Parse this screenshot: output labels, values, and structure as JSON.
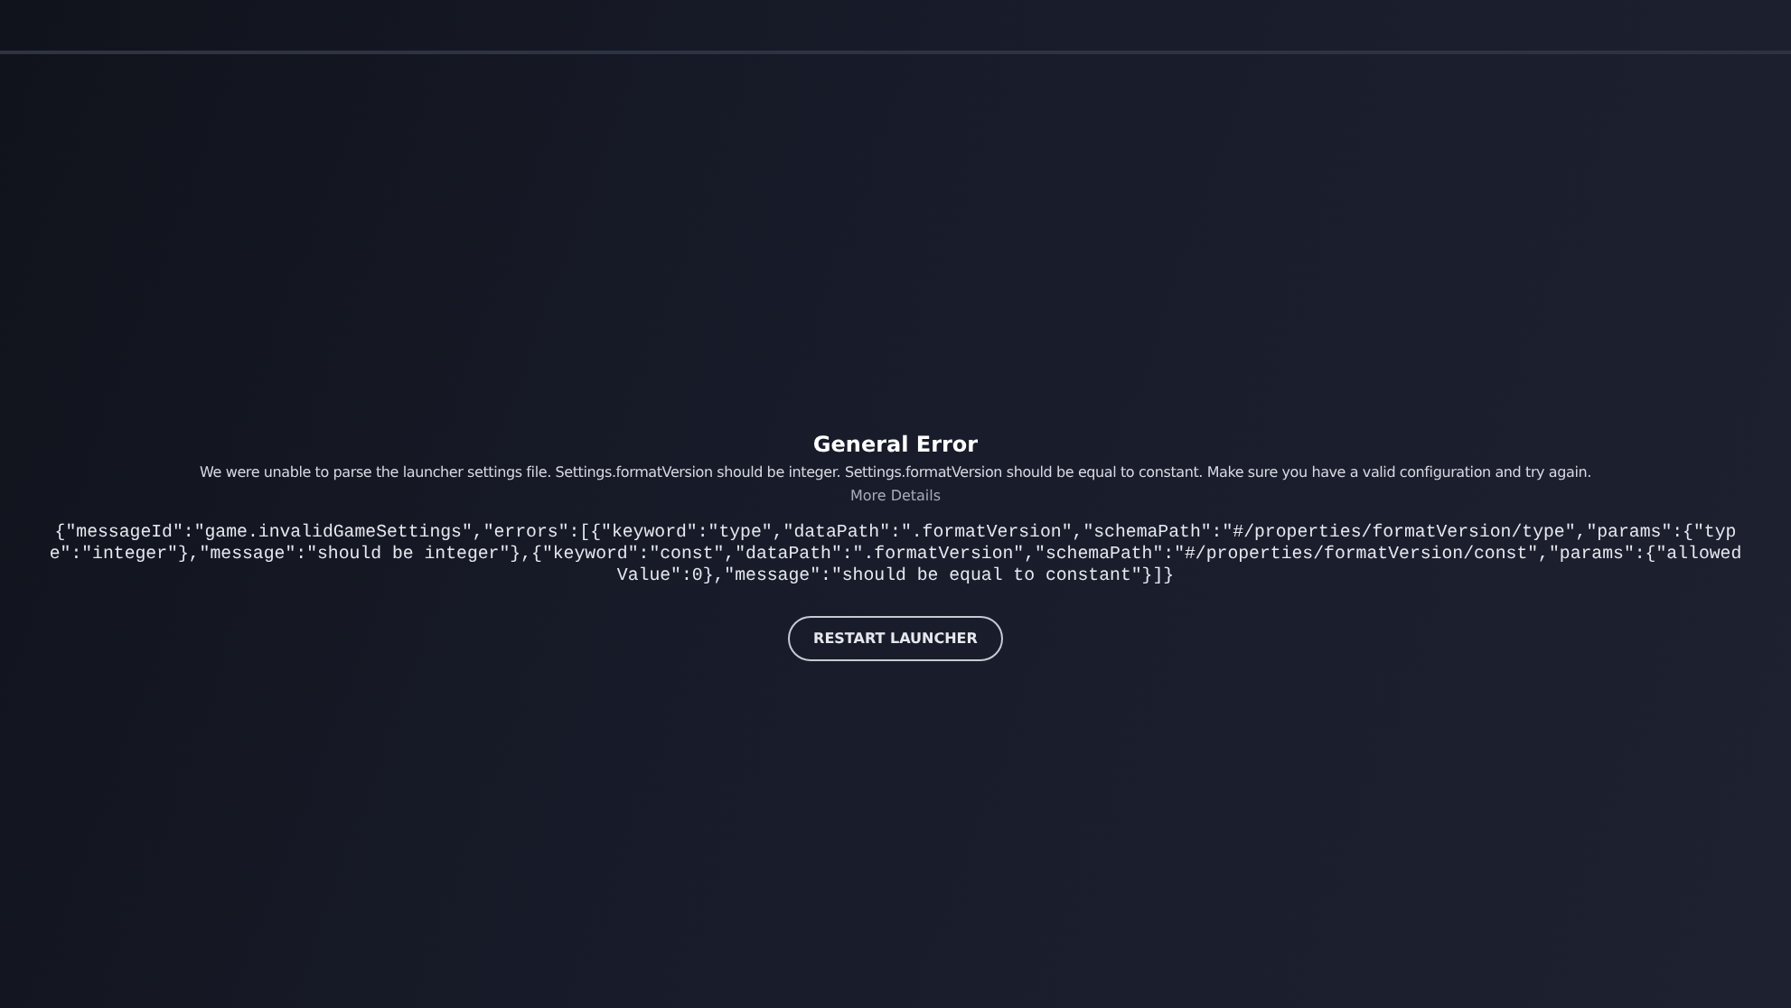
{
  "error": {
    "title": "General Error",
    "message": "We were unable to parse the launcher settings file. Settings.formatVersion should be integer. Settings.formatVersion should be equal to constant. Make sure you have a valid configuration and try again.",
    "details_link": "More Details",
    "details": "{\"messageId\":\"game.invalidGameSettings\",\"errors\":[{\"keyword\":\"type\",\"dataPath\":\".formatVersion\",\"schemaPath\":\"#/properties/formatVersion/type\",\"params\":{\"type\":\"integer\"},\"message\":\"should be integer\"},{\"keyword\":\"const\",\"dataPath\":\".formatVersion\",\"schemaPath\":\"#/properties/formatVersion/const\",\"params\":{\"allowedValue\":0},\"message\":\"should be equal to constant\"}]}"
  },
  "buttons": [
    "RESTART LAUNCHER"
  ]
}
